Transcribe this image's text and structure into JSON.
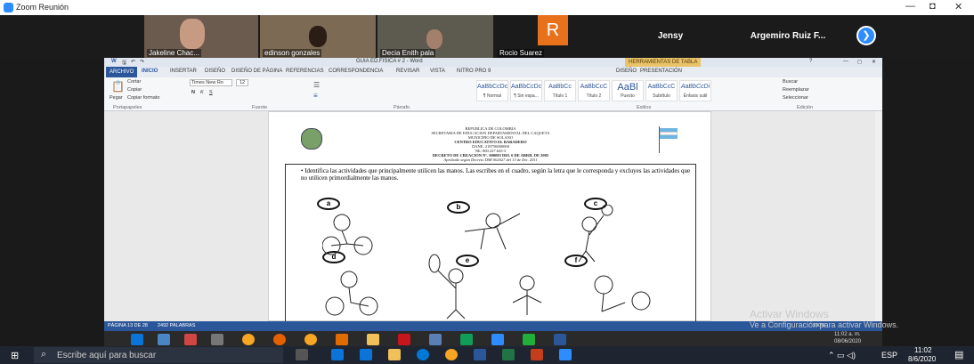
{
  "window": {
    "title": "Zoom Reunión",
    "min": "—",
    "restore": "◘",
    "close": "✕"
  },
  "participants": [
    {
      "name": "Jakeline Chac...",
      "bg": "#6b5a4e"
    },
    {
      "name": "edinson gonzales",
      "bg": "#7c6a55"
    },
    {
      "name": "Decia Enith pala",
      "bg": "#5d5a4f"
    },
    {
      "name": "Rocio Suarez",
      "initial": "R",
      "bg": "#e8711c"
    },
    {
      "name": "Jensy"
    },
    {
      "name": "Argemiro Ruiz F..."
    }
  ],
  "word": {
    "title": "GUIA ED.FISICA # 2 - Word",
    "tools_context": "HERRAMIENTAS DE TABLA",
    "help": "?",
    "tabs": [
      "ARCHIVO",
      "INICIO",
      "INSERTAR",
      "DISEÑO",
      "DISEÑO DE PÁGINA",
      "REFERENCIAS",
      "CORRESPONDENCIA",
      "REVISAR",
      "VISTA",
      "NITRO PRO 9",
      "DISEÑO",
      "PRESENTACIÓN"
    ],
    "clipboard": {
      "paste": "Pegar",
      "cut": "Cortar",
      "copy": "Copiar",
      "format": "Copiar formato",
      "label": "Portapapeles"
    },
    "font": {
      "name": "Times New Ro",
      "size": "12",
      "label": "Fuente"
    },
    "paragraph_label": "Párrafo",
    "styles": [
      {
        "sample": "AaBbCcDc",
        "name": "¶ Normal"
      },
      {
        "sample": "AaBbCcDc",
        "name": "¶ Sin espa..."
      },
      {
        "sample": "AaBbCc",
        "name": "Título 1"
      },
      {
        "sample": "AaBbCcC",
        "name": "Título 2"
      },
      {
        "sample": "AaBl",
        "name": "Puesto"
      },
      {
        "sample": "AaBbCcC",
        "name": "Subtítulo"
      },
      {
        "sample": "AaBbCcDi",
        "name": "Énfasis sutil"
      }
    ],
    "styles_label": "Estilos",
    "editing": {
      "find": "Buscar",
      "replace": "Reemplazar",
      "select": "Seleccionar",
      "label": "Edición"
    },
    "header_lines": [
      "REPUBLICA DE COLOMBIA",
      "SECRETARIA DE EDUCACION DEPARTAMENTAL DEL CAQUETA",
      "MUNICIPIO DE SOLANO",
      "CENTRO EDUCATIVO EL BARADERO",
      "DANE: 218756000068",
      "NIt: 800.227.643-3",
      "DECRETO DE CREACION N°. 000083 DEL 6 DE ABRIL DE 2005",
      "Aprobado según Decreto DSR 002027 del 13 de Dic. 2011"
    ],
    "instruction": "Identifica las actividades que principalmente utilicen las manos. Las escribes en el cuadro, según la letra que le corresponda y excluyes las actividades que no utilicen primordialmente las manos.",
    "letters": [
      "a",
      "b",
      "c",
      "d",
      "e",
      "f"
    ],
    "status": {
      "page": "PÁGINA 13 DE 28",
      "words": "2492 PALABRAS"
    }
  },
  "activate": {
    "title": "Activar Windows",
    "sub": "Ve a Configuración para activar Windows."
  },
  "zoom_tray": {
    "time": "11:02 a. m.",
    "date": "08/06/2020",
    "zoom": "100%"
  },
  "taskbar": {
    "search_placeholder": "Escribe aquí para buscar",
    "lang": "ESP",
    "time": "11:02",
    "date": "8/6/2020"
  }
}
